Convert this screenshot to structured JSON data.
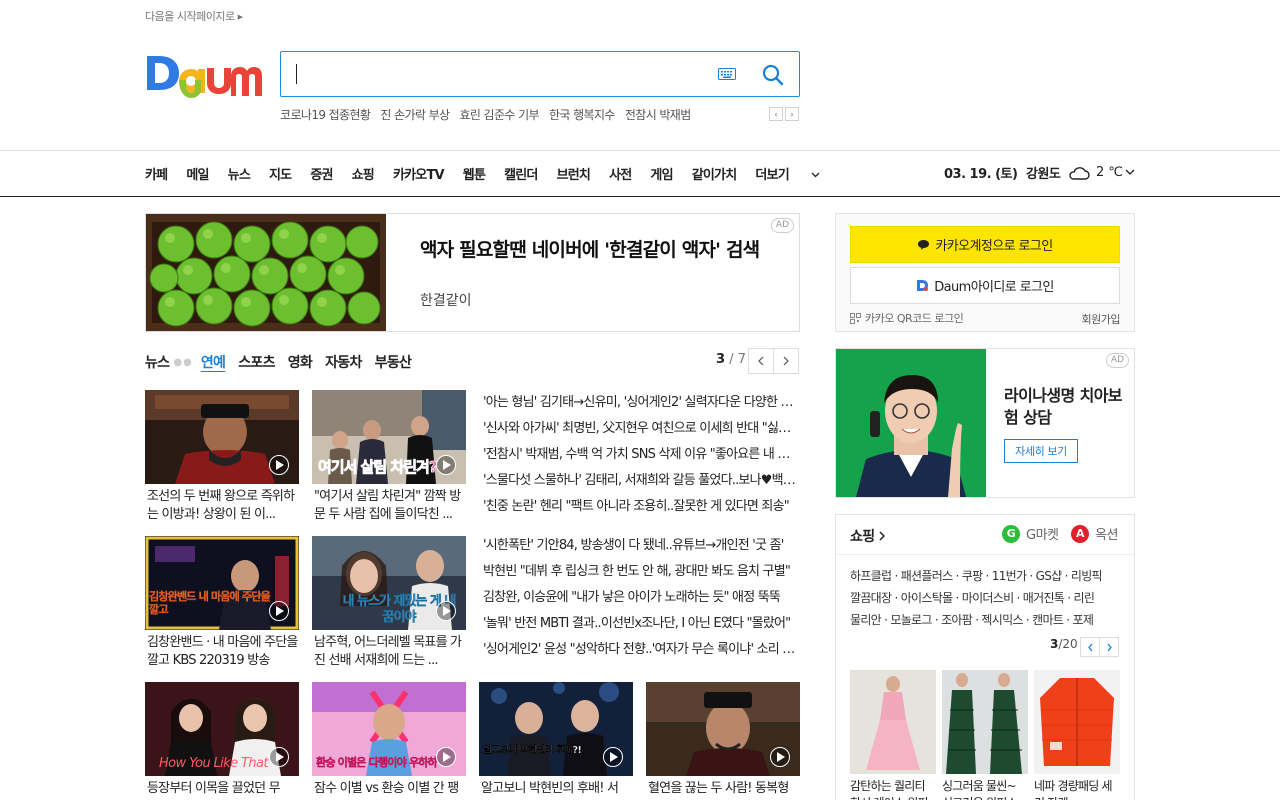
{
  "top": {
    "startpage_label": "다음을 시작페이지로"
  },
  "search": {
    "value": "",
    "placeholder": ""
  },
  "trending": [
    "코로나19 접종현황",
    "진 손가락 부상",
    "효린 김준수 기부",
    "한국 행복지수",
    "전참시 박재범"
  ],
  "trend_nav": {
    "prev": "‹",
    "next": "›"
  },
  "gnb": {
    "items": [
      "카페",
      "메일",
      "뉴스",
      "지도",
      "증권",
      "쇼핑",
      "카카오TV",
      "웹툰",
      "캘린더",
      "브런치",
      "사전",
      "게임",
      "같이가치"
    ],
    "more_label": "더보기",
    "date": "03. 19. (토)",
    "region": "강원도",
    "temp": "2",
    "temp_unit": "℃"
  },
  "ad_banner": {
    "badge": "AD",
    "title": "액자 필요할땐 네이버에 '한결같이 액자' 검색",
    "subtitle": "한결같이"
  },
  "news": {
    "tabs": [
      "뉴스",
      "연예",
      "스포츠",
      "영화",
      "자동차",
      "부동산"
    ],
    "active_tab": "연예",
    "page_current": "3",
    "page_total": "/ 7",
    "thumbs_row1": [
      {
        "caption": "조선의 두 번째 왕으로 즉위하는 이방과! 상왕이 된 이..."
      },
      {
        "caption": "\"여기서 살림 차린겨\" 깜짝 방문 두 사람 집에 들이닥친 ...",
        "overlay_text": "여기서 살림 차린겨?"
      }
    ],
    "headlines_row1": [
      "'아는 형님' 김기태→신유미, '싱어게인2' 실력자다운 다양한 무대",
      "'신사와 아가씨' 최명빈, 父지현우 여친으로 이세희 반대 \"싫어요\"",
      "'전참시' 박재범, 수백 억 가치 SNS 삭제 이유 \"좋아요른 내 사업\"",
      "'스물다섯 스물하나' 김태리, 서재희와 갈등 풀었다..보나♥백이진",
      "'친중 논란' 헨리 \"팩트 아니라 조용히..잘못한 게 있다면 죄송\""
    ],
    "thumbs_row2": [
      {
        "caption": "김창완밴드 · 내 마음에 주단을 깔고 KBS 220319 방송",
        "overlay_text": "김창완밴드 내 마음에 주단을 깔고"
      },
      {
        "caption": "남주혁, 어느더레벨 목표를 가진 선배 서재희에 드는 ...",
        "overlay_text": "내 뉴스가 재밌는 게 내 꿈이야"
      }
    ],
    "headlines_row2": [
      "'시한폭탄' 기안84, 방송생이 다 됐네..유튜브→개인전 '굿 좀'",
      "박현빈 \"데뷔 후 립싱크 한 번도 안 해, 광대만 봐도 음치 구별\"",
      "김창완, 이승윤에 \"내가 낳은 아이가 노래하는 듯\" 애정 뚝뚝",
      "'놀뭐' 반전 MBTI 결과..이선빈x조나단, I 아닌 E였다 \"몰랐어\"",
      "'싱어게인2' 윤성 \"성악하다 전향..'여자가 무슨 록이냐' 소리 들어\""
    ],
    "thumbs_row3": [
      {
        "caption": "등장부터 이목을 끌었던 무",
        "overlay_text": "How You Like That"
      },
      {
        "caption": "잠수 이별 vs 환승 이별 간 팽",
        "overlay_text": "환승 이별은 다행이야 우하하"
      },
      {
        "caption": "알고보니 박현빈의 후배! 서",
        "overlay_text": "알고보니 박현빈의 후배?!"
      },
      {
        "caption": "혈연을 끊는 두 사람! 동복형"
      }
    ]
  },
  "login": {
    "kakao_label": "카카오계정으로 로그인",
    "daum_label": "Daum아이디로 로그인",
    "qr_label": "카카오 QR코드 로그인",
    "signup_label": "회원가입"
  },
  "ad_side": {
    "badge": "AD",
    "title": "라이나생명 치아보험 상담",
    "button": "자세히 보기"
  },
  "shopping": {
    "title": "쇼핑",
    "gmarket_label": "G마켓",
    "auction_label": "옥션",
    "links": [
      "하프클럽 · 패션플러스 · 쿠팡 · 11번가 · GS샵 · 리빙픽",
      "깔끔대장 · 아이스탁몰 · 마이더스비 · 매거진톡 · 리린",
      "물리안 · 모놀로그 · 조아팜 · 젝시믹스 · 캔마트 · 포제"
    ],
    "page_current": "3",
    "page_total": "/20",
    "items": [
      {
        "caption": "감탄하는 퀄리티 핫시 레이스 원피스"
      },
      {
        "caption": "싱그러움 물씬~ 싱그러운 원피스"
      },
      {
        "caption": "네파 경량패딩 세컨 자켓"
      }
    ]
  },
  "colors": {
    "accent": "#1b7fd6",
    "kakao": "#fee500",
    "border": "#1b8fd8"
  }
}
